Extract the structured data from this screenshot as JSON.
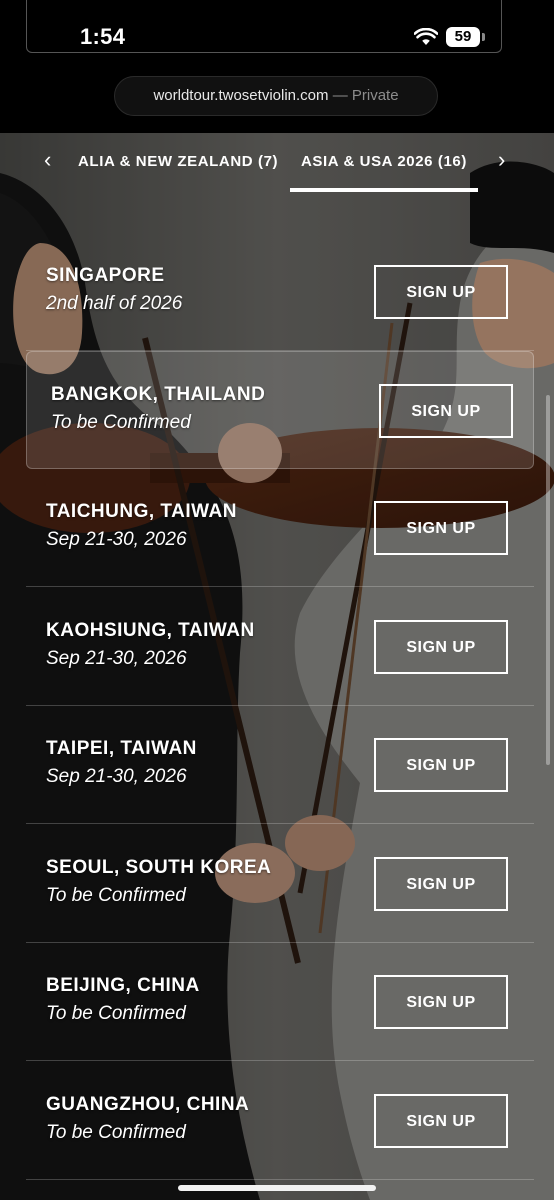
{
  "status_bar": {
    "time": "1:54",
    "battery": "59"
  },
  "browser": {
    "domain": "worldtour.twosetviolin.com",
    "separator": "—",
    "mode": "Private"
  },
  "tabs": [
    {
      "label": "ALIA & NEW ZEALAND (7)",
      "selected": false
    },
    {
      "label": "ASIA & USA 2026 (16)",
      "selected": true
    }
  ],
  "tours": [
    {
      "city": "SINGAPORE",
      "date": "2nd half of 2026",
      "button": "SIGN UP"
    },
    {
      "city": "BANGKOK, THAILAND",
      "date": "To be Confirmed",
      "button": "SIGN UP",
      "highlighted": true
    },
    {
      "city": "TAICHUNG, TAIWAN",
      "date": "Sep 21-30, 2026",
      "button": "SIGN UP"
    },
    {
      "city": "KAOHSIUNG, TAIWAN",
      "date": "Sep 21-30, 2026",
      "button": "SIGN UP"
    },
    {
      "city": "TAIPEI, TAIWAN",
      "date": "Sep 21-30, 2026",
      "button": "SIGN UP"
    },
    {
      "city": "SEOUL, SOUTH KOREA",
      "date": "To be Confirmed",
      "button": "SIGN UP"
    },
    {
      "city": "BEIJING, CHINA",
      "date": "To be Confirmed",
      "button": "SIGN UP"
    },
    {
      "city": "GUANGZHOU, CHINA",
      "date": "To be Confirmed",
      "button": "SIGN UP"
    }
  ],
  "icons": {
    "prev": "chevron-left-icon",
    "next": "chevron-right-icon",
    "wifi": "wifi-icon"
  }
}
